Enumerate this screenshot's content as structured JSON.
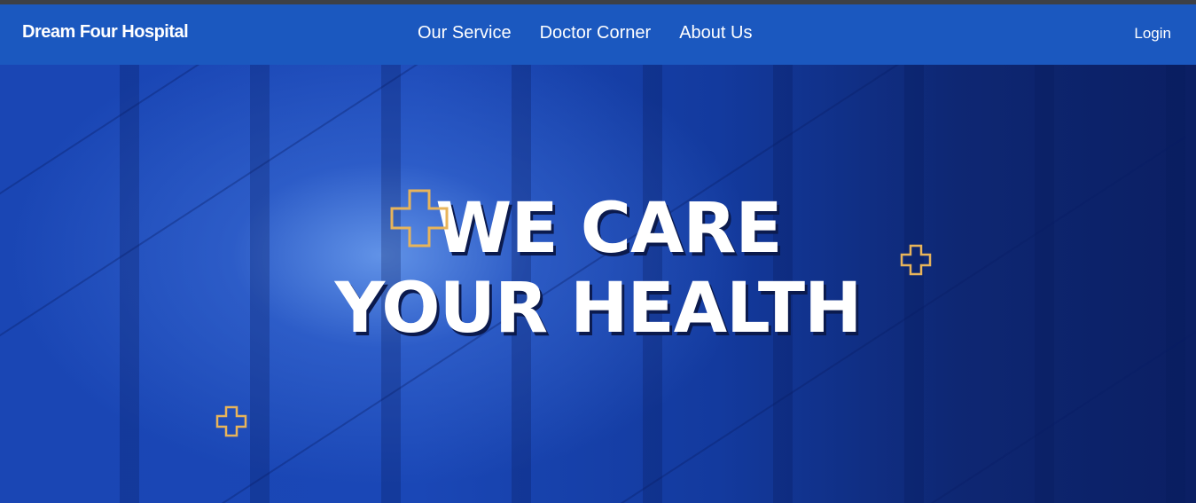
{
  "navbar": {
    "brand": "Dream Four Hospital",
    "links": [
      "Our Service",
      "Doctor Corner",
      "About Us"
    ],
    "login": "Login",
    "color": "#1b58bf"
  },
  "hero": {
    "line1": "WE CARE",
    "line2": "YOUR HEALTH",
    "cross_color": "#e8b45a",
    "background_color": "#1a47b6"
  },
  "icons": [
    "medical-cross-icon"
  ]
}
